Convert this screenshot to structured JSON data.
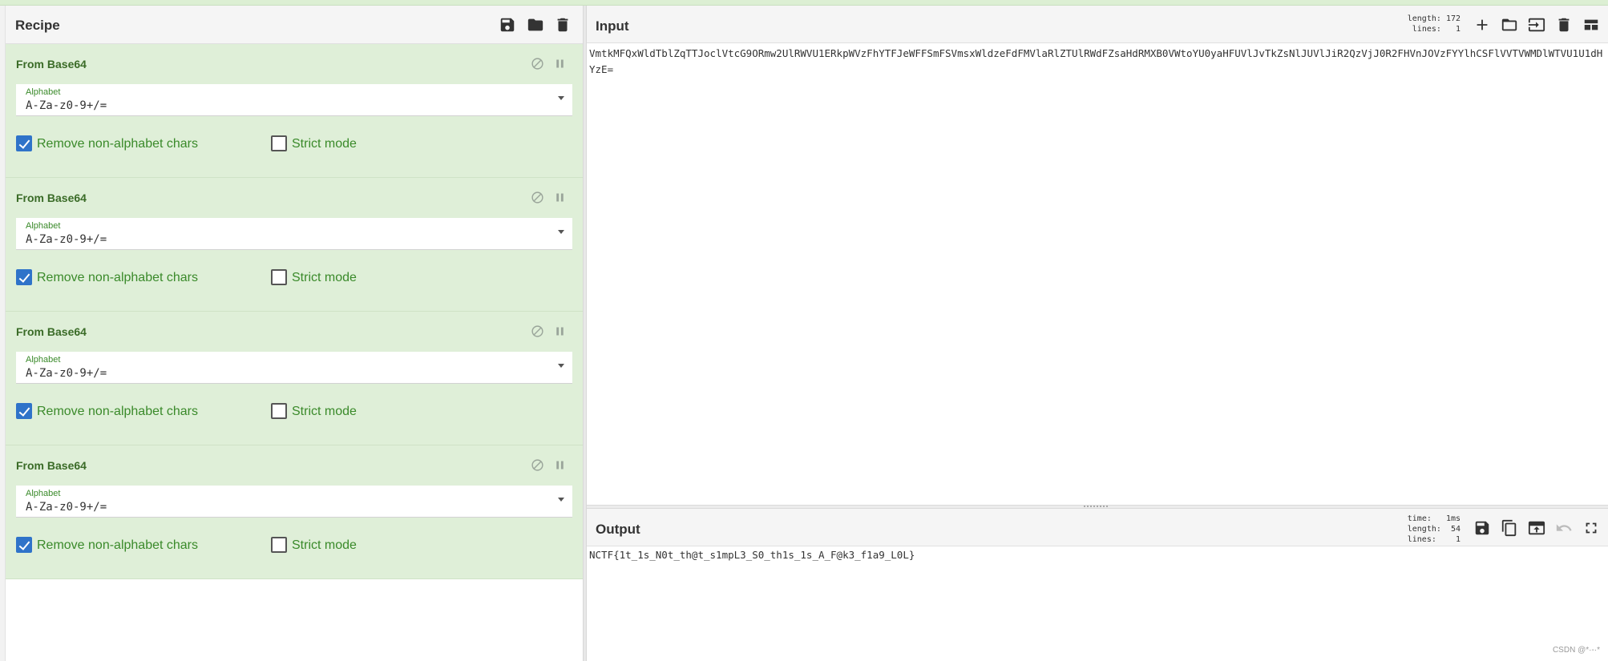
{
  "recipe": {
    "title": "Recipe",
    "operations": [
      {
        "name": "From Base64",
        "alphabet_label": "Alphabet",
        "alphabet_value": "A-Za-z0-9+/=",
        "remove_non_alpha_label": "Remove non-alphabet chars",
        "remove_non_alpha_checked": true,
        "strict_mode_label": "Strict mode",
        "strict_mode_checked": false
      },
      {
        "name": "From Base64",
        "alphabet_label": "Alphabet",
        "alphabet_value": "A-Za-z0-9+/=",
        "remove_non_alpha_label": "Remove non-alphabet chars",
        "remove_non_alpha_checked": true,
        "strict_mode_label": "Strict mode",
        "strict_mode_checked": false
      },
      {
        "name": "From Base64",
        "alphabet_label": "Alphabet",
        "alphabet_value": "A-Za-z0-9+/=",
        "remove_non_alpha_label": "Remove non-alphabet chars",
        "remove_non_alpha_checked": true,
        "strict_mode_label": "Strict mode",
        "strict_mode_checked": false
      },
      {
        "name": "From Base64",
        "alphabet_label": "Alphabet",
        "alphabet_value": "A-Za-z0-9+/=",
        "remove_non_alpha_label": "Remove non-alphabet chars",
        "remove_non_alpha_checked": true,
        "strict_mode_label": "Strict mode",
        "strict_mode_checked": false
      }
    ]
  },
  "input": {
    "title": "Input",
    "length_label": "length:",
    "length_value": "172",
    "lines_label": "lines:",
    "lines_value": "1",
    "text": "VmtkMFQxWldTblZqTTJoclVtcG9ORmw2UlRWVU1ERkpWVzFhYTFJeWFFSmFSVmsxWldzeFdFMVlaRlZTUlRWdFZsaHdRMXB0VWtoYU0yaHFUVlJvTkZsNlJUVlJiR2QzVjJ0R2FHVnJOVzFYYlhCSFlVVTVWMDlWTVU1U1dHYzE="
  },
  "output": {
    "title": "Output",
    "time_label": "time:",
    "time_value": "1ms",
    "length_label": "length:",
    "length_value": "54",
    "lines_label": "lines:",
    "lines_value": "1",
    "text": "NCTF{1t_1s_N0t_th@t_s1mpL3_S0_th1s_1s_A_F@k3_f1a9_L0L}"
  },
  "watermark": "CSDN @*·-·*"
}
